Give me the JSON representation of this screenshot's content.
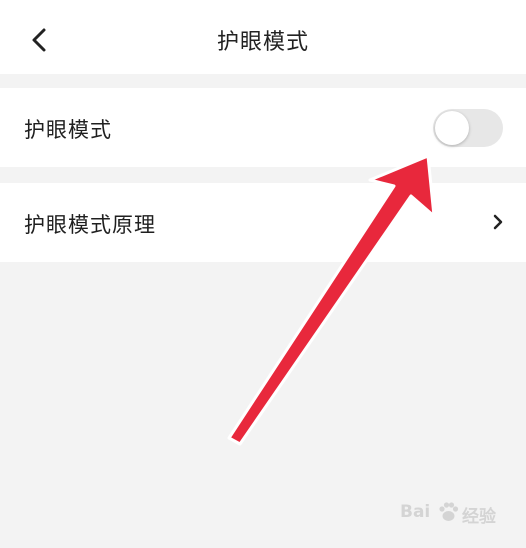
{
  "header": {
    "title": "护眼模式",
    "back_icon": "chevron-left-icon"
  },
  "settings": [
    {
      "label": "护眼模式",
      "control": "toggle",
      "toggle_on": false
    },
    {
      "label": "护眼模式原理",
      "control": "chevron",
      "icon": "chevron-right-icon"
    }
  ],
  "annotation": {
    "type": "arrow",
    "color": "#e8283c"
  },
  "watermark": {
    "text_left": "Bai",
    "text_right": "经验"
  },
  "colors": {
    "background": "#f3f3f3",
    "row_background": "#ffffff",
    "toggle_off": "#e7e7e7",
    "text": "#1f1f1f"
  }
}
